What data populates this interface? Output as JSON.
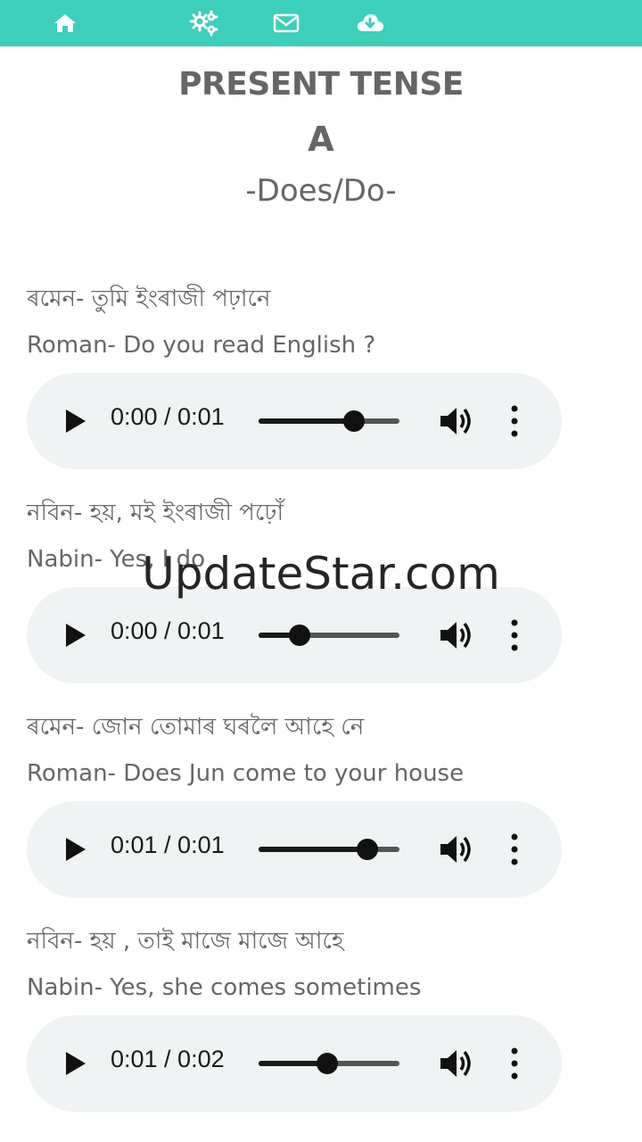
{
  "nav": {
    "color": "#3ccfb9",
    "icons": [
      "home-icon",
      "settings-icon",
      "mail-icon",
      "cloud-download-icon"
    ]
  },
  "header": {
    "title": "PRESENT TENSE",
    "letter": "A",
    "subtitle": "-Does/Do-"
  },
  "dialogues": [
    {
      "native": "ৰমেন- তুমি ইংৰাজী পঢ়ানে",
      "english": "Roman- Do you read English ?",
      "player": {
        "time": "0:00 / 0:01",
        "progress": 0.68
      }
    },
    {
      "native": "নবিন- হয়, মই ইংৰাজী পঢ়োঁ",
      "english": "Nabin-  Yes, I do",
      "player": {
        "time": "0:00 / 0:01",
        "progress": 0.29
      }
    },
    {
      "native": "ৰমেন- জোন তোমাৰ ঘৰলৈ আহে নে",
      "english": "Roman-  Does Jun come to your house",
      "player": {
        "time": "0:01 / 0:01",
        "progress": 0.77
      }
    },
    {
      "native": "নবিন- হয় , তাই মাজে মাজে আহে",
      "english": "Nabin- Yes, she comes sometimes",
      "player": {
        "time": "0:01 / 0:02",
        "progress": 0.49
      }
    }
  ],
  "watermark": "UpdateStar.com"
}
